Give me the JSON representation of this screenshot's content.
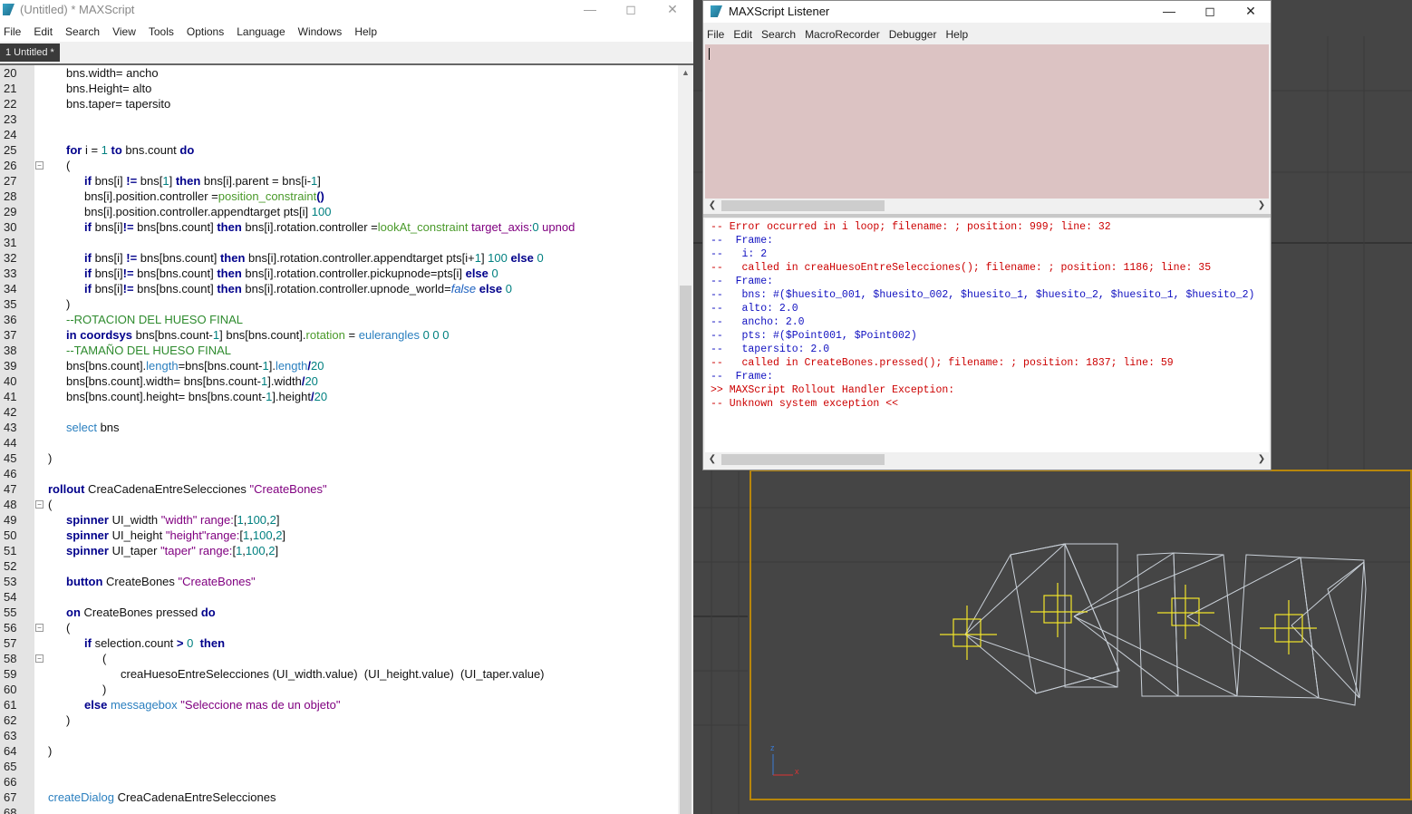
{
  "editor": {
    "title": "(Untitled) * MAXScript",
    "menu": [
      "File",
      "Edit",
      "Search",
      "View",
      "Tools",
      "Options",
      "Language",
      "Windows",
      "Help"
    ],
    "tab": "1 Untitled *",
    "lines": [
      {
        "n": "20",
        "indent": 1,
        "segs": [
          [
            "bns.width= ancho",
            ""
          ]
        ]
      },
      {
        "n": "21",
        "indent": 1,
        "segs": [
          [
            "bns.Height= alto",
            ""
          ]
        ]
      },
      {
        "n": "22",
        "indent": 1,
        "segs": [
          [
            "bns.taper= tapersito",
            ""
          ]
        ]
      },
      {
        "n": "23",
        "indent": 0,
        "segs": []
      },
      {
        "n": "24",
        "indent": 0,
        "segs": []
      },
      {
        "n": "25",
        "indent": 1,
        "segs": [
          [
            "for",
            "kw"
          ],
          [
            " i = ",
            ""
          ],
          [
            "1",
            "num-c"
          ],
          [
            " ",
            ""
          ],
          [
            "to",
            "kw"
          ],
          [
            " bns.count ",
            ""
          ],
          [
            "do",
            "kw"
          ]
        ]
      },
      {
        "n": "26",
        "indent": 1,
        "fold": true,
        "segs": [
          [
            "(",
            ""
          ]
        ]
      },
      {
        "n": "27",
        "indent": 2,
        "segs": [
          [
            "if",
            "kw"
          ],
          [
            " bns[i] ",
            ""
          ],
          [
            "!=",
            "kw"
          ],
          [
            " bns[",
            ""
          ],
          [
            "1",
            "num-c"
          ],
          [
            "] ",
            ""
          ],
          [
            "then",
            "kw"
          ],
          [
            " bns[i].parent = bns[i-",
            ""
          ],
          [
            "1",
            "num-c"
          ],
          [
            "]",
            ""
          ]
        ]
      },
      {
        "n": "28",
        "indent": 2,
        "segs": [
          [
            "bns[i].position.controller =",
            ""
          ],
          [
            "position_constraint",
            "obj"
          ],
          [
            "()",
            "kw"
          ]
        ]
      },
      {
        "n": "29",
        "indent": 2,
        "segs": [
          [
            "bns[i].position.controller.appendtarget pts[i] ",
            ""
          ],
          [
            "100",
            "num-c"
          ]
        ]
      },
      {
        "n": "30",
        "indent": 2,
        "segs": [
          [
            "if",
            "kw"
          ],
          [
            " bns[i]",
            ""
          ],
          [
            "!=",
            "kw"
          ],
          [
            " bns[bns.count] ",
            ""
          ],
          [
            "then",
            "kw"
          ],
          [
            " bns[i].rotation.controller =",
            ""
          ],
          [
            "lookAt_constraint",
            "obj"
          ],
          [
            " ",
            ""
          ],
          [
            "target_axis:",
            "str"
          ],
          [
            "0",
            "num-c"
          ],
          [
            " upnod",
            "str"
          ]
        ]
      },
      {
        "n": "31",
        "indent": 0,
        "segs": []
      },
      {
        "n": "32",
        "indent": 2,
        "segs": [
          [
            "if",
            "kw"
          ],
          [
            " bns[i] ",
            ""
          ],
          [
            "!=",
            "kw"
          ],
          [
            " bns[bns.count] ",
            ""
          ],
          [
            "then",
            "kw"
          ],
          [
            " bns[i].rotation.controller.appendtarget pts[i+",
            ""
          ],
          [
            "1",
            "num-c"
          ],
          [
            "] ",
            ""
          ],
          [
            "100",
            "num-c"
          ],
          [
            " ",
            ""
          ],
          [
            "else",
            "kw"
          ],
          [
            " ",
            ""
          ],
          [
            "0",
            "num-c"
          ]
        ]
      },
      {
        "n": "33",
        "indent": 2,
        "segs": [
          [
            "if",
            "kw"
          ],
          [
            " bns[i]",
            ""
          ],
          [
            "!=",
            "kw"
          ],
          [
            " bns[bns.count] ",
            ""
          ],
          [
            "then",
            "kw"
          ],
          [
            " bns[i].rotation.controller.pickupnode=pts[i] ",
            ""
          ],
          [
            "else",
            "kw"
          ],
          [
            " ",
            ""
          ],
          [
            "0",
            "num-c"
          ]
        ]
      },
      {
        "n": "34",
        "indent": 2,
        "segs": [
          [
            "if",
            "kw"
          ],
          [
            " bns[i]",
            ""
          ],
          [
            "!=",
            "kw"
          ],
          [
            " bns[bns.count] ",
            ""
          ],
          [
            "then",
            "kw"
          ],
          [
            " bns[i].rotation.controller.upnode_world=",
            ""
          ],
          [
            "false",
            "it"
          ],
          [
            " ",
            ""
          ],
          [
            "else",
            "kw"
          ],
          [
            " ",
            ""
          ],
          [
            "0",
            "num-c"
          ]
        ]
      },
      {
        "n": "35",
        "indent": 1,
        "segs": [
          [
            ")",
            ""
          ]
        ]
      },
      {
        "n": "36",
        "indent": 1,
        "segs": [
          [
            "--ROTACION DEL HUESO FINAL",
            "cmt"
          ]
        ]
      },
      {
        "n": "37",
        "indent": 1,
        "segs": [
          [
            "in",
            "kw"
          ],
          [
            " ",
            ""
          ],
          [
            "coordsys",
            "kw"
          ],
          [
            " bns[bns.count-",
            ""
          ],
          [
            "1",
            "num-c"
          ],
          [
            "] bns[bns.count].",
            ""
          ],
          [
            "rotation",
            "obj"
          ],
          [
            " = ",
            ""
          ],
          [
            "eulerangles",
            "fn"
          ],
          [
            " ",
            ""
          ],
          [
            "0 0 0",
            "num-c"
          ]
        ]
      },
      {
        "n": "38",
        "indent": 1,
        "segs": [
          [
            "--TAMAÑO DEL HUESO FINAL",
            "cmt"
          ]
        ]
      },
      {
        "n": "39",
        "indent": 1,
        "segs": [
          [
            "bns[bns.count].",
            ""
          ],
          [
            "length",
            "fn"
          ],
          [
            "=bns[bns.count-",
            ""
          ],
          [
            "1",
            "num-c"
          ],
          [
            "].",
            ""
          ],
          [
            "length",
            "fn"
          ],
          [
            "/",
            "kw"
          ],
          [
            "20",
            "num-c"
          ]
        ]
      },
      {
        "n": "40",
        "indent": 1,
        "segs": [
          [
            "bns[bns.count].width= bns[bns.count-",
            ""
          ],
          [
            "1",
            "num-c"
          ],
          [
            "].width",
            ""
          ],
          [
            "/",
            "kw"
          ],
          [
            "20",
            "num-c"
          ]
        ]
      },
      {
        "n": "41",
        "indent": 1,
        "segs": [
          [
            "bns[bns.count].height= bns[bns.count-",
            ""
          ],
          [
            "1",
            "num-c"
          ],
          [
            "].height",
            ""
          ],
          [
            "/",
            "kw"
          ],
          [
            "20",
            "num-c"
          ]
        ]
      },
      {
        "n": "42",
        "indent": 0,
        "segs": []
      },
      {
        "n": "43",
        "indent": 1,
        "segs": [
          [
            "select",
            "fn"
          ],
          [
            " bns",
            ""
          ]
        ]
      },
      {
        "n": "44",
        "indent": 0,
        "segs": []
      },
      {
        "n": "45",
        "indent": 0,
        "segs": [
          [
            ")",
            ""
          ]
        ]
      },
      {
        "n": "46",
        "indent": 0,
        "segs": []
      },
      {
        "n": "47",
        "indent": 0,
        "segs": [
          [
            "rollout",
            "kw"
          ],
          [
            " CreaCadenaEntreSelecciones ",
            ""
          ],
          [
            "\"CreateBones\"",
            "str"
          ]
        ]
      },
      {
        "n": "48",
        "indent": 0,
        "fold": true,
        "segs": [
          [
            "(",
            ""
          ]
        ]
      },
      {
        "n": "49",
        "indent": 1,
        "segs": [
          [
            "spinner",
            "kw"
          ],
          [
            " UI_width ",
            ""
          ],
          [
            "\"width\"",
            "str"
          ],
          [
            " ",
            ""
          ],
          [
            "range:",
            "str"
          ],
          [
            "[",
            ""
          ],
          [
            "1",
            "num-c"
          ],
          [
            ",",
            ""
          ],
          [
            "100",
            "num-c"
          ],
          [
            ",",
            ""
          ],
          [
            "2",
            "num-c"
          ],
          [
            "]",
            ""
          ]
        ]
      },
      {
        "n": "50",
        "indent": 1,
        "segs": [
          [
            "spinner",
            "kw"
          ],
          [
            " UI_height ",
            ""
          ],
          [
            "\"height\"",
            "str"
          ],
          [
            "range:",
            "str"
          ],
          [
            "[",
            ""
          ],
          [
            "1",
            "num-c"
          ],
          [
            ",",
            ""
          ],
          [
            "100",
            "num-c"
          ],
          [
            ",",
            ""
          ],
          [
            "2",
            "num-c"
          ],
          [
            "]",
            ""
          ]
        ]
      },
      {
        "n": "51",
        "indent": 1,
        "segs": [
          [
            "spinner",
            "kw"
          ],
          [
            " UI_taper ",
            ""
          ],
          [
            "\"taper\"",
            "str"
          ],
          [
            " ",
            ""
          ],
          [
            "range:",
            "str"
          ],
          [
            "[",
            ""
          ],
          [
            "1",
            "num-c"
          ],
          [
            ",",
            ""
          ],
          [
            "100",
            "num-c"
          ],
          [
            ",",
            ""
          ],
          [
            "2",
            "num-c"
          ],
          [
            "]",
            ""
          ]
        ]
      },
      {
        "n": "52",
        "indent": 0,
        "segs": []
      },
      {
        "n": "53",
        "indent": 1,
        "segs": [
          [
            "button",
            "kw"
          ],
          [
            " CreateBones ",
            ""
          ],
          [
            "\"CreateBones\"",
            "str"
          ]
        ]
      },
      {
        "n": "54",
        "indent": 0,
        "segs": []
      },
      {
        "n": "55",
        "indent": 1,
        "segs": [
          [
            "on",
            "kw"
          ],
          [
            " CreateBones pressed ",
            ""
          ],
          [
            "do",
            "kw"
          ]
        ]
      },
      {
        "n": "56",
        "indent": 1,
        "fold": true,
        "segs": [
          [
            "(",
            ""
          ]
        ]
      },
      {
        "n": "57",
        "indent": 2,
        "segs": [
          [
            "if",
            "kw"
          ],
          [
            " selection.count ",
            ""
          ],
          [
            ">",
            "kw"
          ],
          [
            " ",
            ""
          ],
          [
            "0",
            "num-c"
          ],
          [
            "  ",
            ""
          ],
          [
            "then",
            "kw"
          ]
        ]
      },
      {
        "n": "58",
        "indent": 3,
        "fold": true,
        "segs": [
          [
            "(",
            ""
          ]
        ]
      },
      {
        "n": "59",
        "indent": 4,
        "segs": [
          [
            "creaHuesoEntreSelecciones (UI_width.value)  (UI_height.value)  (UI_taper.value)",
            ""
          ]
        ]
      },
      {
        "n": "60",
        "indent": 3,
        "segs": [
          [
            ")",
            ""
          ]
        ]
      },
      {
        "n": "61",
        "indent": 2,
        "segs": [
          [
            "else",
            "kw"
          ],
          [
            " ",
            ""
          ],
          [
            "messagebox",
            "fn"
          ],
          [
            " ",
            ""
          ],
          [
            "\"Seleccione mas de un objeto\"",
            "str"
          ]
        ]
      },
      {
        "n": "62",
        "indent": 1,
        "segs": [
          [
            ")",
            ""
          ]
        ]
      },
      {
        "n": "63",
        "indent": 0,
        "segs": []
      },
      {
        "n": "64",
        "indent": 0,
        "segs": [
          [
            ")",
            ""
          ]
        ]
      },
      {
        "n": "65",
        "indent": 0,
        "segs": []
      },
      {
        "n": "66",
        "indent": 0,
        "segs": []
      },
      {
        "n": "67",
        "indent": 0,
        "segs": [
          [
            "createDialog",
            "fn"
          ],
          [
            " CreaCadenaEntreSelecciones",
            ""
          ]
        ]
      },
      {
        "n": "68",
        "indent": 0,
        "segs": []
      }
    ]
  },
  "listener": {
    "title": "MAXScript Listener",
    "menu": [
      "File",
      "Edit",
      "Search",
      "MacroRecorder",
      "Debugger",
      "Help"
    ],
    "output": [
      {
        "text": "-- Error occurred in i loop; filename: ; position: 999; line: 32",
        "color": "red"
      },
      {
        "text": "--  Frame:",
        "color": "blue"
      },
      {
        "text": "--   i: 2",
        "color": "blue"
      },
      {
        "text": "--   called in creaHuesoEntreSelecciones(); filename: ; position: 1186; line: 35",
        "color": "red"
      },
      {
        "text": "--  Frame:",
        "color": "blue"
      },
      {
        "text": "--   bns: #($huesito_001, $huesito_002, $huesito_1, $huesito_2, $huesito_1, $huesito_2)",
        "color": "blue"
      },
      {
        "text": "--   alto: 2.0",
        "color": "blue"
      },
      {
        "text": "--   ancho: 2.0",
        "color": "blue"
      },
      {
        "text": "--   pts: #($Point001, $Point002)",
        "color": "blue"
      },
      {
        "text": "--   tapersito: 2.0",
        "color": "blue"
      },
      {
        "text": "--   called in CreateBones.pressed(); filename: ; position: 1837; line: 59",
        "color": "red"
      },
      {
        "text": "--  Frame:",
        "color": "blue"
      },
      {
        "text": ">> MAXScript Rollout Handler Exception:",
        "color": "red"
      },
      {
        "text": "-- Unknown system exception <<",
        "color": "red"
      }
    ]
  },
  "viewport": {
    "axis_z": "z",
    "axis_x": "x"
  },
  "colors": {
    "listener_input_bg": "#dcc3c3",
    "error_red": "#cc0000",
    "frame_blue": "#1010c0",
    "viewport_bg": "#454545",
    "active_border": "#b8860b"
  }
}
